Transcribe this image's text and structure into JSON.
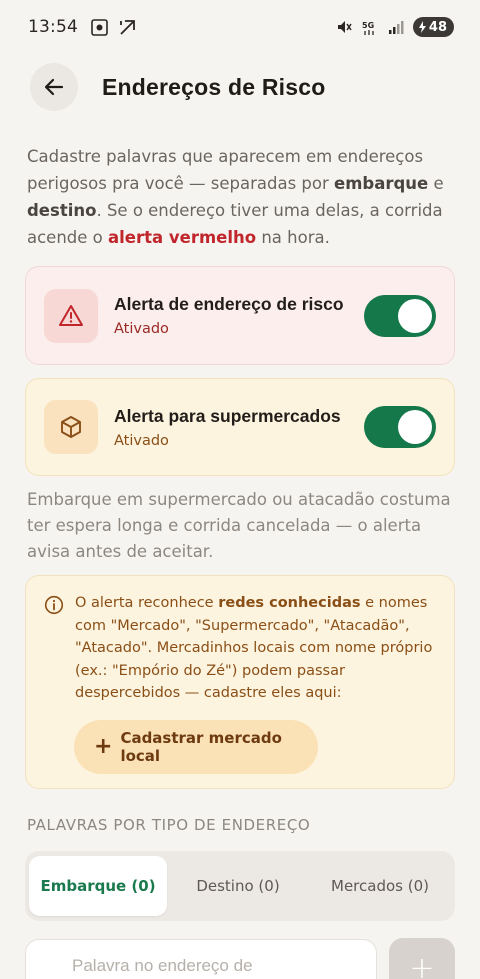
{
  "status_bar": {
    "time": "13:54",
    "battery": "48",
    "icons": [
      "screen-record-icon",
      "navigation-arrow-icon",
      "mute-icon",
      "5g-icon",
      "signal-icon",
      "battery-icon"
    ]
  },
  "header": {
    "title": "Endereços de Risco",
    "back_icon": "arrow-left-icon"
  },
  "intro": {
    "part1": "Cadastre palavras que aparecem em endereços perigosos pra você — separadas por ",
    "bold1": "embarque",
    "part2": " e ",
    "bold2": "destino",
    "part3": ". Se o endereço tiver uma delas, a corrida acende o ",
    "red": "alerta vermelho",
    "part4": " na hora."
  },
  "risk_alert": {
    "title": "Alerta de endereço de risco",
    "status": "Ativado",
    "enabled": true,
    "icon": "warning-triangle-icon"
  },
  "market_alert": {
    "title": "Alerta para supermercados",
    "status": "Ativado",
    "enabled": true,
    "icon": "package-box-icon"
  },
  "market_note": "Embarque em supermercado ou atacadão costuma ter espera longa e corrida cancelada — o alerta avisa antes de aceitar.",
  "info_box": {
    "t1": "O alerta reconhece ",
    "b1": "redes conhecidas",
    "t2": " e nomes com \"Mercado\", \"Supermercado\", \"Atacadão\", \"Atacado\". Mercadinhos locais com nome próprio (ex.: \"Empório do Zé\") podem passar despercebidos — cadastre eles aqui:",
    "button_label": "Cadastrar mercado local",
    "button_icon": "+"
  },
  "section_label": "PALAVRAS POR TIPO DE ENDEREÇO",
  "tabs": [
    {
      "label": "Embarque (0)",
      "active": true
    },
    {
      "label": "Destino (0)",
      "active": false
    },
    {
      "label": "Mercados (0)",
      "active": false
    }
  ],
  "word_input": {
    "placeholder": "Palavra no endereço de",
    "add_button": "+"
  },
  "colors": {
    "accent_green": "#15784a",
    "alert_red": "#c0262b",
    "amber_text": "#8a4f17"
  }
}
